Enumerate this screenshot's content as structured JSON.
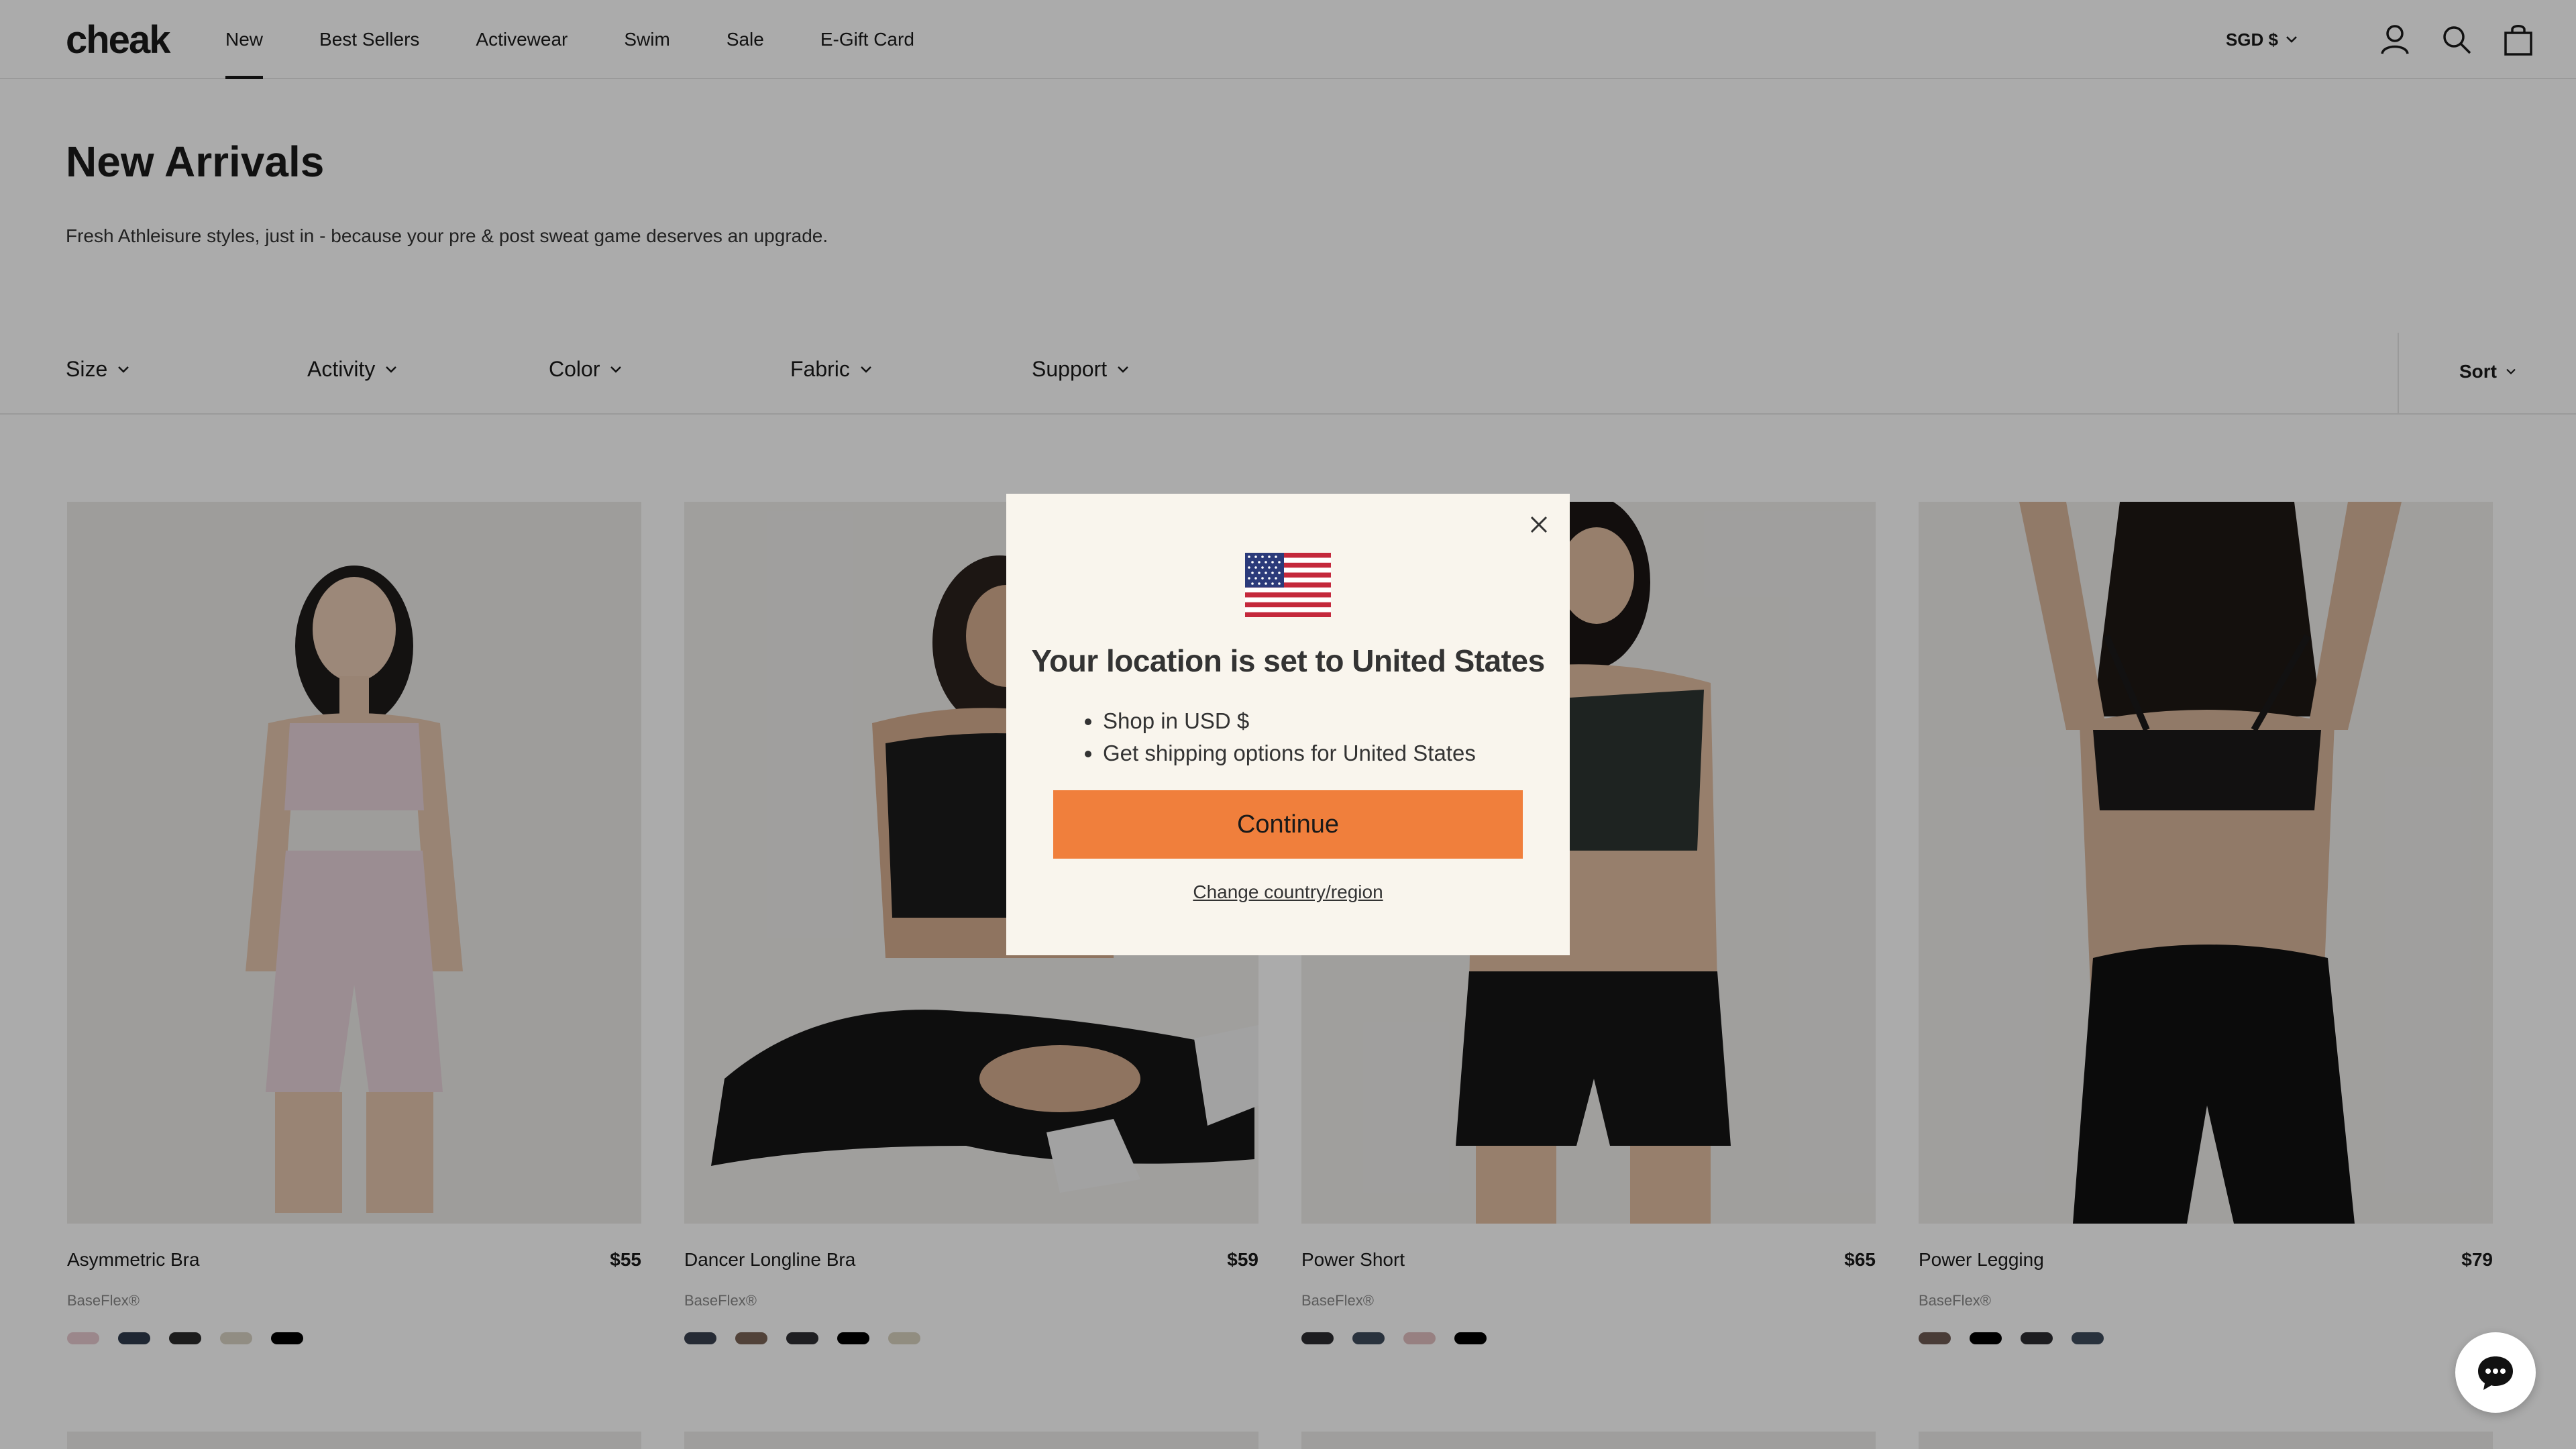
{
  "brand": {
    "logo": "cheak"
  },
  "nav": [
    {
      "label": "New",
      "active": true
    },
    {
      "label": "Best Sellers"
    },
    {
      "label": "Activewear"
    },
    {
      "label": "Swim"
    },
    {
      "label": "Sale"
    },
    {
      "label": "E-Gift Card"
    }
  ],
  "header": {
    "currency": "SGD $"
  },
  "page": {
    "title": "New Arrivals",
    "subtitle": "Fresh Athleisure styles, just in - because your pre & post sweat game deserves an upgrade."
  },
  "filters": [
    "Size",
    "Activity",
    "Color",
    "Fabric",
    "Support"
  ],
  "sort_label": "Sort",
  "products": [
    {
      "name": "Asymmetric Bra",
      "price": "$55",
      "fabric": "BaseFlex®",
      "swatches": [
        "#e8c9cf",
        "#2f3b4c",
        "#2b2b2b",
        "#d9d3c3",
        "#000000"
      ]
    },
    {
      "name": "Dancer Longline Bra",
      "price": "$59",
      "fabric": "BaseFlex®",
      "swatches": [
        "#3a4150",
        "#7a6356",
        "#2f2f33",
        "#000000",
        "#d8d2bf"
      ]
    },
    {
      "name": "Power Short",
      "price": "$65",
      "fabric": "BaseFlex®",
      "swatches": [
        "#2c2c30",
        "#3e4b5c",
        "#e1bfc1",
        "#000000"
      ]
    },
    {
      "name": "Power Legging",
      "price": "$79",
      "fabric": "BaseFlex®",
      "swatches": [
        "#6d5a52",
        "#000000",
        "#2c2c30",
        "#3e4b5c"
      ]
    }
  ],
  "modal": {
    "title": "Your location is set to United States",
    "bullets": [
      "Shop in USD $",
      "Get shipping options for United States"
    ],
    "continue_label": "Continue",
    "change_label": "Change country/region"
  },
  "colors": {
    "accent": "#f07f3c",
    "modal_bg": "#f9f5ed"
  }
}
